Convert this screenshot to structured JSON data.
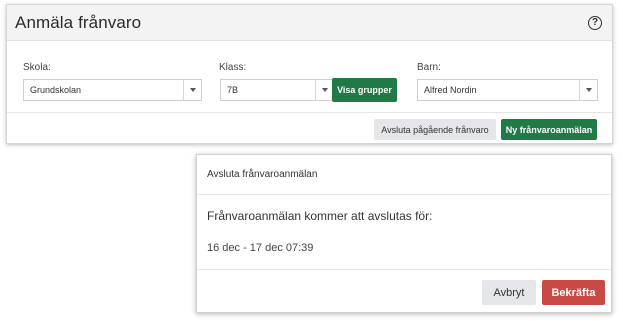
{
  "panel": {
    "title": "Anmäla frånvaro",
    "help_icon": "question-circle-icon",
    "help_glyph": "?",
    "school": {
      "label": "Skola:",
      "value": "Grundskolan"
    },
    "klass": {
      "label": "Klass:",
      "value": "7B",
      "show_groups_button": "Visa grupper"
    },
    "child": {
      "label": "Barn:",
      "value": "Alfred Nordin"
    },
    "end_ongoing_button": "Avsluta pågående frånvaro",
    "new_report_button": "Ny frånvaroanmälan"
  },
  "modal": {
    "title": "Avsluta frånvaroanmälan",
    "message": "Frånvaroanmälan kommer att avslutas för:",
    "period": "16 dec - 17 dec 07:39",
    "cancel_button": "Avbryt",
    "confirm_button": "Bekräfta"
  },
  "colors": {
    "primary_green": "#1f7a45",
    "danger_red": "#c94a44",
    "neutral_button": "#e4e6ea"
  }
}
